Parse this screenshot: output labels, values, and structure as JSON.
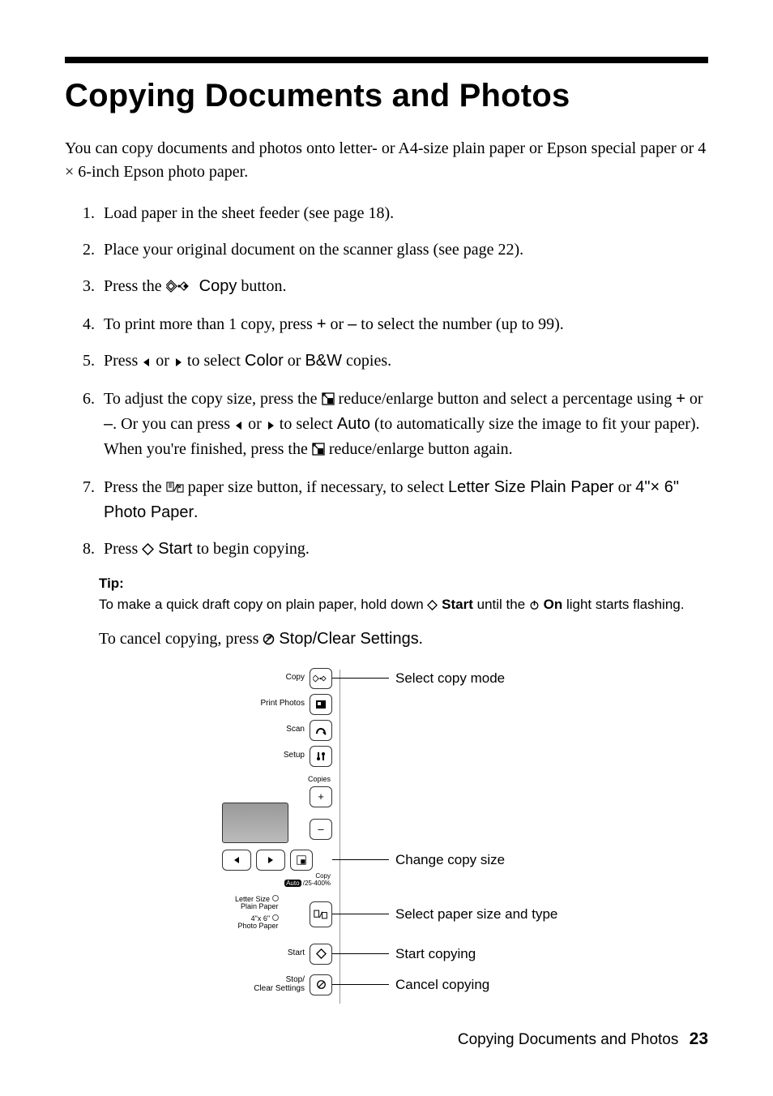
{
  "heading": "Copying Documents and Photos",
  "intro": "You can copy documents and photos onto letter- or A4-size plain paper or Epson special paper or 4 × 6-inch Epson photo paper.",
  "steps": {
    "s1": "Load paper in the sheet feeder (see page 18).",
    "s2": "Place your original document on the scanner glass (see page 22).",
    "s3_a": "Press the ",
    "s3_copy": "Copy",
    "s3_b": " button.",
    "s4_a": "To print more than 1 copy, press ",
    "s4_b": " or ",
    "s4_c": " to select the number (up to 99).",
    "s4_plus": "+",
    "s4_minus": "–",
    "s5_a": "Press ",
    "s5_b": " or ",
    "s5_c": " to select ",
    "s5_color": "Color",
    "s5_d": " or ",
    "s5_bw": "B&W",
    "s5_e": " copies.",
    "s6_a": "To adjust the copy size, press the ",
    "s6_b": " reduce/enlarge button and select a percentage using ",
    "s6_plus": "+",
    "s6_c": " or ",
    "s6_minus": "–",
    "s6_d": ". Or you can press ",
    "s6_e": " or ",
    "s6_f": " to select ",
    "s6_auto": "Auto",
    "s6_g": " (to automatically size the image to fit your paper). When you're finished, press the ",
    "s6_h": " reduce/enlarge button again.",
    "s7_a": "Press the ",
    "s7_b": " paper size button, if necessary, to select ",
    "s7_letter": "Letter Size Plain Paper",
    "s7_c": " or ",
    "s7_photo": "4\"× 6\" Photo Paper",
    "s7_d": ".",
    "s8_a": "Press ",
    "s8_start": "Start",
    "s8_b": " to begin copying."
  },
  "tip": {
    "label": "Tip:",
    "a": "To make a quick draft copy on plain paper, hold down ",
    "start": "Start",
    "b": " until the ",
    "on": "On",
    "c": " light starts flashing."
  },
  "cancel": {
    "a": "To cancel copying, press ",
    "stop": "Stop/Clear Settings",
    "b": "."
  },
  "panel": {
    "rows": {
      "copy": "Copy",
      "print_photos": "Print Photos",
      "scan": "Scan",
      "setup": "Setup",
      "copies": "Copies",
      "copy_range": "Copy",
      "copy_range2": "Auto /25-400%",
      "letter": "Letter Size",
      "letter2": "Plain Paper",
      "photo": "4\"x 6\"",
      "photo2": "Photo Paper",
      "start": "Start",
      "stop": "Stop/",
      "stop2": "Clear Settings"
    },
    "annot": {
      "a1": "Select copy mode",
      "a2": "Change copy size",
      "a3": "Select paper size and type",
      "a4": "Start copying",
      "a5": "Cancel copying"
    }
  },
  "footer": {
    "title": "Copying Documents and Photos",
    "page": "23"
  }
}
